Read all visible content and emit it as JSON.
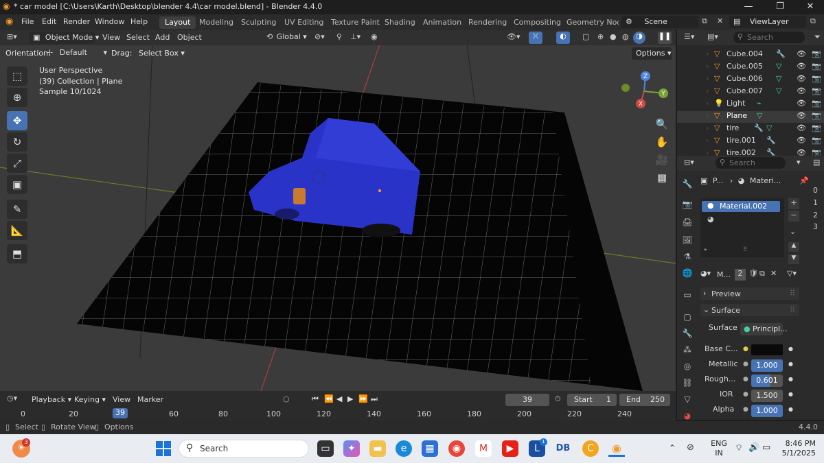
{
  "title_bar": {
    "text": "* car model [C:\\Users\\Karth\\Desktop\\blender 4.4\\car model.blend] - Blender 4.4.0",
    "min": "—",
    "max": "❐",
    "close": "✕"
  },
  "menu": {
    "items": [
      "File",
      "Edit",
      "Render",
      "Window",
      "Help"
    ]
  },
  "workspaces": [
    "Layout",
    "Modeling",
    "Sculpting",
    "UV Editing",
    "Texture Paint",
    "Shading",
    "Animation",
    "Rendering",
    "Compositing",
    "Geometry Node"
  ],
  "scene": {
    "label": "Scene"
  },
  "view_layer": {
    "label": "ViewLayer"
  },
  "viewport_header": {
    "mode": "Object Mode",
    "view": "View",
    "select": "Select",
    "add": "Add",
    "object": "Object",
    "transform": "Global"
  },
  "tool_settings": {
    "orientation_label": "Orientation:",
    "orientation_value": "Default",
    "drag_label": "Drag:",
    "drag_value": "Select Box",
    "options": "Options"
  },
  "viewport_info": {
    "line1": "User Perspective",
    "line2": "(39) Collection | Plane",
    "line3": "Sample 10/1024"
  },
  "gizmo": {
    "x": "X",
    "y": "Y",
    "z": "Z"
  },
  "outliner": {
    "search_placeholder": "Search",
    "items": [
      {
        "name": "Cube.004"
      },
      {
        "name": "Cube.005"
      },
      {
        "name": "Cube.006"
      },
      {
        "name": "Cube.007"
      },
      {
        "name": "Light"
      },
      {
        "name": "Plane"
      },
      {
        "name": "tire"
      },
      {
        "name": "tire.001"
      },
      {
        "name": "tire.002"
      }
    ]
  },
  "properties": {
    "search_placeholder": "Search",
    "breadcrumb_object": "P...",
    "breadcrumb_material": "Materi...",
    "material_slot": "Material.002",
    "data_block_name": "M...",
    "users": "2",
    "preview": "Preview",
    "surface_section": "Surface",
    "surface_label": "Surface",
    "surface_value": "Principl...",
    "base_color_label": "Base C...",
    "metallic_label": "Metallic",
    "metallic_value": "1.000",
    "roughness_label": "Rough...",
    "roughness_value": "0.601",
    "ior_label": "IOR",
    "ior_value": "1.500",
    "alpha_label": "Alpha",
    "alpha_value": "1.000",
    "side_numbers": [
      "0",
      "1",
      "2",
      "3"
    ]
  },
  "timeline": {
    "playback": "Playback",
    "keying": "Keying",
    "view": "View",
    "marker": "Marker",
    "current_frame": "39",
    "start_label": "Start",
    "start_value": "1",
    "end_label": "End",
    "end_value": "250",
    "ruler": [
      "0",
      "20",
      "39",
      "60",
      "80",
      "100",
      "120",
      "140",
      "160",
      "180",
      "200",
      "220",
      "240"
    ]
  },
  "status": {
    "select": "Select",
    "rotate": "Rotate View",
    "options": "Options",
    "version": "4.4.0"
  },
  "taskbar": {
    "search_placeholder": "Search",
    "language": "ENG",
    "region": "IN",
    "time": "8:46 PM",
    "date": "5/1/2025",
    "notify_badge": "3",
    "apps": [
      "file-explorer",
      "edge",
      "store",
      "chrome",
      "gmail",
      "youtube",
      "launcher",
      "db",
      "c-app",
      "blender"
    ]
  }
}
